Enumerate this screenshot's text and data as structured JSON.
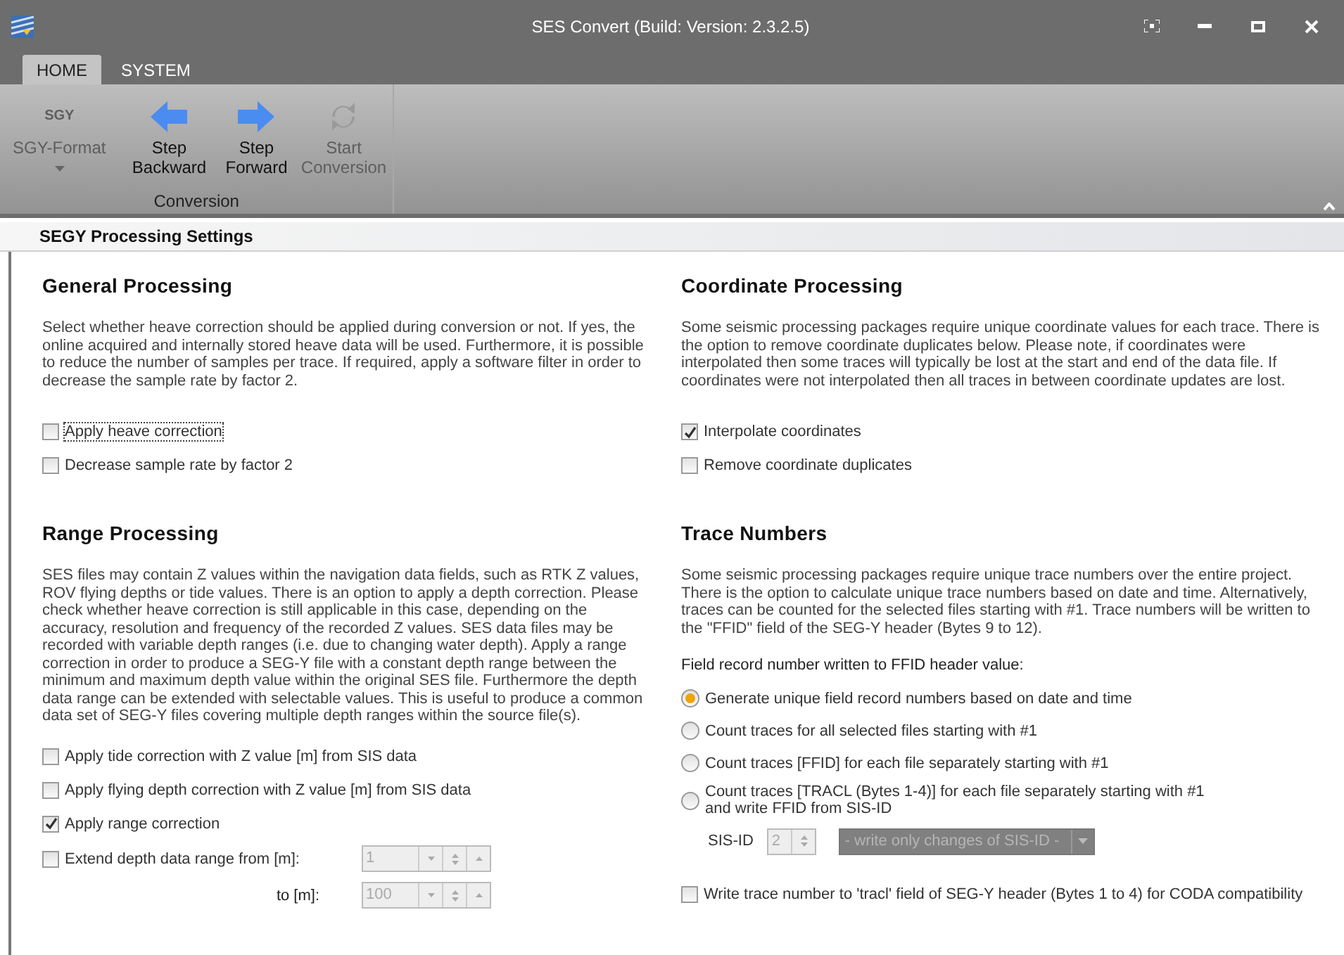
{
  "window": {
    "title": "SES Convert (Build: Version: 2.3.2.5)"
  },
  "tabs": [
    {
      "label": "HOME",
      "selected": true
    },
    {
      "label": "SYSTEM",
      "selected": false
    }
  ],
  "ribbon": {
    "buttons": [
      {
        "kind": "format",
        "label": "SGY-Format",
        "icon_text": "SGY",
        "disabled": true
      },
      {
        "kind": "back",
        "label": "Step Backward",
        "disabled": false
      },
      {
        "kind": "forward",
        "label": "Step Forward",
        "disabled": false
      },
      {
        "kind": "convert",
        "label": "Start Conversion",
        "disabled": true
      }
    ],
    "group_label": "Conversion"
  },
  "section_header": "SEGY Processing Settings",
  "general": {
    "title": "General Processing",
    "description": "Select whether heave correction should be applied during conversion or not. If yes, the online acquired and internally stored heave data will be used. Furthermore, it is possible to reduce the number of samples per trace. If required, apply a software filter in order to decrease the sample rate by factor 2.",
    "options": [
      {
        "label": "Apply heave correction",
        "checked": false,
        "focused": true
      },
      {
        "label": "Decrease sample rate by factor 2",
        "checked": false,
        "focused": false
      }
    ]
  },
  "coordinate": {
    "title": "Coordinate Processing",
    "description": "Some seismic processing packages require unique coordinate values for each trace. There is the option to remove coordinate duplicates below. Please note, if coordinates were interpolated then some traces will typically be lost at the start and end of the data file. If coordinates were not interpolated then all traces in between coordinate updates are lost.",
    "options": [
      {
        "label": "Interpolate coordinates",
        "checked": true,
        "focused": false
      },
      {
        "label": "Remove coordinate duplicates",
        "checked": false,
        "focused": false
      }
    ]
  },
  "range": {
    "title": "Range Processing",
    "description": "SES files may contain Z values within the navigation data fields, such as RTK Z values, ROV flying depths or tide values. There is an option to apply a depth correction. Please check whether heave correction is still applicable in this case, depending on the accuracy, resolution and frequency of the recorded Z values. SES data files may be recorded with variable depth ranges (i.e. due to changing water depth). Apply a range correction in order to produce a SEG-Y file with a constant depth range between the minimum and maximum depth value within the original SES file. Furthermore the depth data range can be extended with selectable values. This is useful to produce a common data set of SEG-Y files covering multiple depth ranges within the source file(s).",
    "options": [
      {
        "label": "Apply tide correction with Z value [m] from SIS data",
        "checked": false,
        "focused": false
      },
      {
        "label": "Apply flying depth correction with Z value [m] from SIS data",
        "checked": false,
        "focused": false
      },
      {
        "label": "Apply range correction",
        "checked": true,
        "focused": false
      }
    ],
    "extend": {
      "label": "Extend depth data range from [m]:",
      "checked": false,
      "from_value": "1",
      "to_label": "to [m]:",
      "to_value": "100",
      "disabled": true
    }
  },
  "trace": {
    "title": "Trace Numbers",
    "description": "Some seismic processing packages require unique trace numbers over the entire project. There is the option to calculate unique trace numbers based on date and time. Alternatively, traces can be counted for the selected files starting with #1. Trace numbers will be written to the \"FFID\" field of the SEG-Y header (Bytes 9 to 12).",
    "radio_label": "Field record number written to FFID header value:",
    "radios": [
      {
        "label": "Generate unique field record numbers based on date and time",
        "selected": true
      },
      {
        "label": "Count traces for all selected files starting with #1",
        "selected": false
      },
      {
        "label": "Count traces [FFID] for each file separately starting with #1",
        "selected": false
      },
      {
        "label": "Count traces [TRACL (Bytes 1-4)] for each file separately starting with #1\nand write FFID from SIS-ID",
        "selected": false
      }
    ],
    "sis_id": {
      "label": "SIS-ID",
      "value": "2",
      "mode": "- write only changes of SIS-ID -",
      "disabled": true
    },
    "tracl_option": {
      "label": "Write trace number to 'tracl' field of SEG-Y header (Bytes 1 to 4) for CODA compatibility",
      "checked": false
    }
  }
}
